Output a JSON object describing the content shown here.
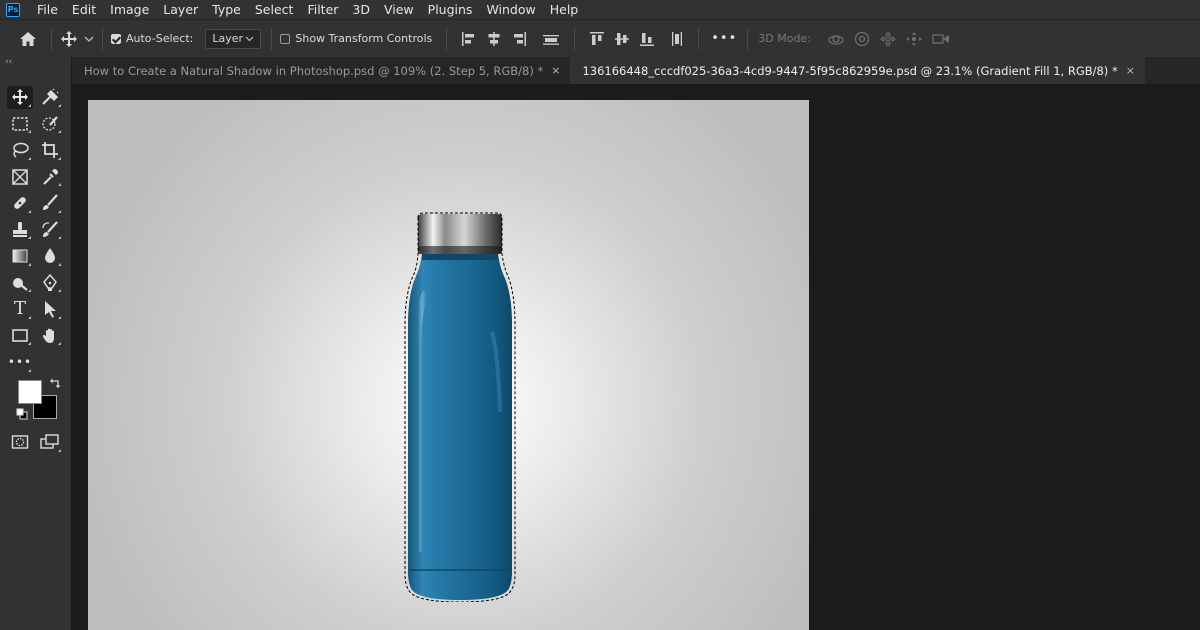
{
  "app": {
    "logo_text": "Ps"
  },
  "menu": [
    "File",
    "Edit",
    "Image",
    "Layer",
    "Type",
    "Select",
    "Filter",
    "3D",
    "View",
    "Plugins",
    "Window",
    "Help"
  ],
  "options": {
    "auto_select_label": "Auto-Select:",
    "auto_select_checked": true,
    "layer_dropdown": "Layer",
    "show_transform_label": "Show Transform Controls",
    "show_transform_checked": false,
    "more_label": "•••",
    "mode_3d_label": "3D Mode:"
  },
  "tabs": [
    {
      "label": "How to Create a Natural Shadow in Photoshop.psd @ 109% (2. Step 5, RGB/8) *",
      "active": false
    },
    {
      "label": "136166448_cccdf025-36a3-4cd9-9447-5f95c862959e.psd @ 23.1% (Gradient Fill 1, RGB/8) *",
      "active": true
    }
  ],
  "tab_close": "×",
  "toolbar": {
    "collapse": "‹‹",
    "edit_toolbar": "•••",
    "type_glyph": "T",
    "foreground_color": "#ffffff",
    "background_color": "#000000"
  },
  "colors": {
    "menubar_bg": "#323232",
    "workspace_bg": "#1c1c1c",
    "bottle_blue": "#1d6a93"
  }
}
